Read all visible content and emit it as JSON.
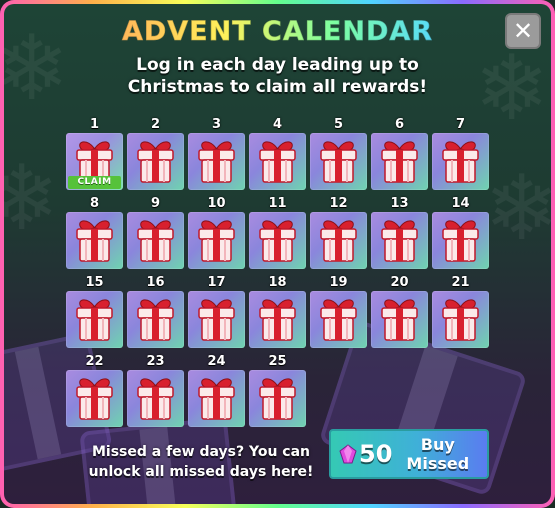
{
  "header": {
    "title": "ADVENT CALENDAR",
    "close_symbol": "✕",
    "subtitle_line1": "Log in each day leading up to",
    "subtitle_line2": "Christmas to claim all rewards!"
  },
  "calendar": {
    "days": [
      {
        "day": "1",
        "claim_label": "CLAIM"
      },
      {
        "day": "2"
      },
      {
        "day": "3"
      },
      {
        "day": "4"
      },
      {
        "day": "5"
      },
      {
        "day": "6"
      },
      {
        "day": "7"
      },
      {
        "day": "8"
      },
      {
        "day": "9"
      },
      {
        "day": "10"
      },
      {
        "day": "11"
      },
      {
        "day": "12"
      },
      {
        "day": "13"
      },
      {
        "day": "14"
      },
      {
        "day": "15"
      },
      {
        "day": "16"
      },
      {
        "day": "17"
      },
      {
        "day": "18"
      },
      {
        "day": "19"
      },
      {
        "day": "20"
      },
      {
        "day": "21"
      },
      {
        "day": "22"
      },
      {
        "day": "23"
      },
      {
        "day": "24"
      },
      {
        "day": "25"
      }
    ],
    "reward_icon": "gift-box-icon"
  },
  "footer": {
    "missed_line1": "Missed a few days? You can",
    "missed_line2": "unlock all missed days here!",
    "buy_price": "50",
    "buy_label_line1": "Buy",
    "buy_label_line2": "Missed",
    "currency_icon": "gem-icon"
  },
  "colors": {
    "claim_green": "#56c23a",
    "buy_button_start": "#35c9b4",
    "buy_button_end": "#5a7cf0",
    "gem_pink": "#e04adf"
  }
}
